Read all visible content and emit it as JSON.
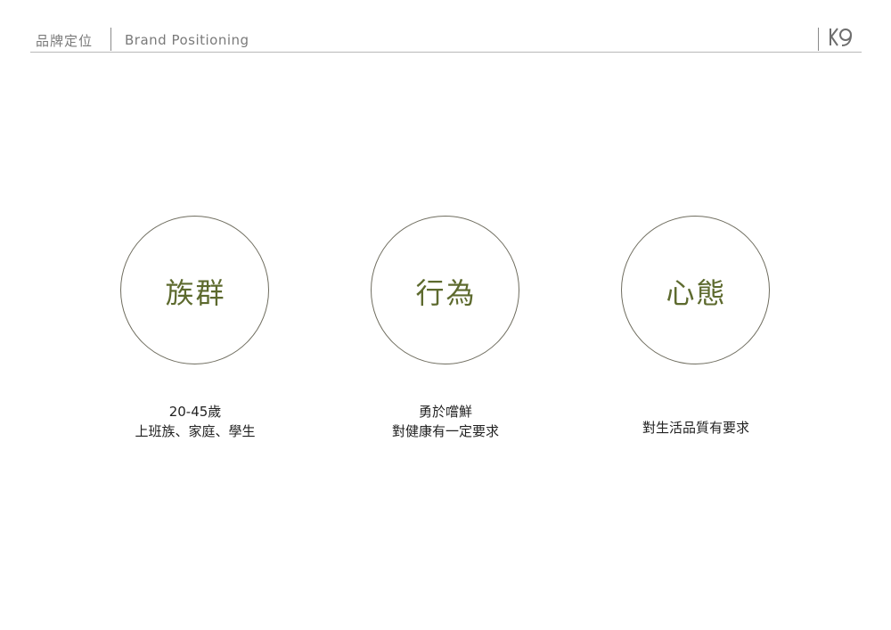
{
  "header": {
    "title_zh": "品牌定位",
    "title_en": "Brand Positioning",
    "logo_icon": "k9-logo-icon"
  },
  "colors": {
    "accent": "#5d6a2e",
    "circle_border": "#6f6d5f",
    "header_text": "#7a7a7a",
    "rule": "#b9b9b9"
  },
  "pillars": [
    {
      "title": "族群",
      "lines": [
        "20-45歲",
        "上班族、家庭、學生"
      ]
    },
    {
      "title": "行為",
      "lines": [
        "勇於嚐鮮",
        "對健康有一定要求"
      ]
    },
    {
      "title": "心態",
      "lines": [
        "對生活品質有要求"
      ]
    }
  ]
}
